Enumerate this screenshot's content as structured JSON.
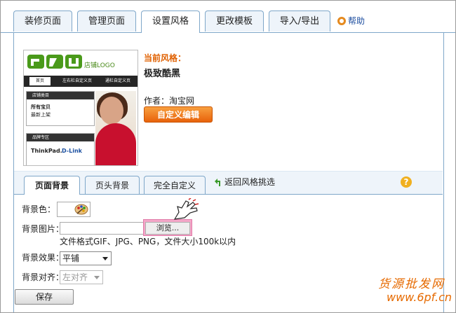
{
  "top_tabs": [
    "装修页面",
    "管理页面",
    "设置风格",
    "更改模板",
    "导入/导出"
  ],
  "active_top_tab": 2,
  "help_label": "帮助",
  "preview": {
    "logo_caption": "店铺LOGO",
    "nav": [
      "首页",
      "左右栏自定义页",
      "通栏自定义页"
    ],
    "side_box1_title": "店铺类目",
    "side_box1_items": [
      "所有宝贝",
      "最新上架"
    ],
    "side_box2_title": "品牌专区",
    "brands": [
      "ThinkPad.",
      "D-Link"
    ]
  },
  "current_style": {
    "label": "当前风格：",
    "name": "极致酷黑",
    "author": "作者：淘宝网",
    "customize_button": "自定义编辑"
  },
  "sub_tabs": [
    "页面背景",
    "页头背景",
    "完全自定义"
  ],
  "active_sub_tab": 0,
  "back_link": "返回风格挑选",
  "form": {
    "bg_color_label": "背景色：",
    "bg_image_label": "背景图片：",
    "browse_button": "浏览...",
    "file_hint": "文件格式GIF、JPG、PNG，文件大小100k以内",
    "bg_effect_label": "背景效果：",
    "bg_effect_value": "平铺",
    "bg_align_label": "背景对齐：",
    "bg_align_value": "左对齐",
    "save_button": "保存"
  },
  "watermark": {
    "line1": "货源批发网",
    "line2": "www.6pf.cn"
  },
  "colors": {
    "tab_border": "#7fa7c9",
    "accent_orange": "#e06000",
    "browse_highlight": "#f4a7c8"
  }
}
